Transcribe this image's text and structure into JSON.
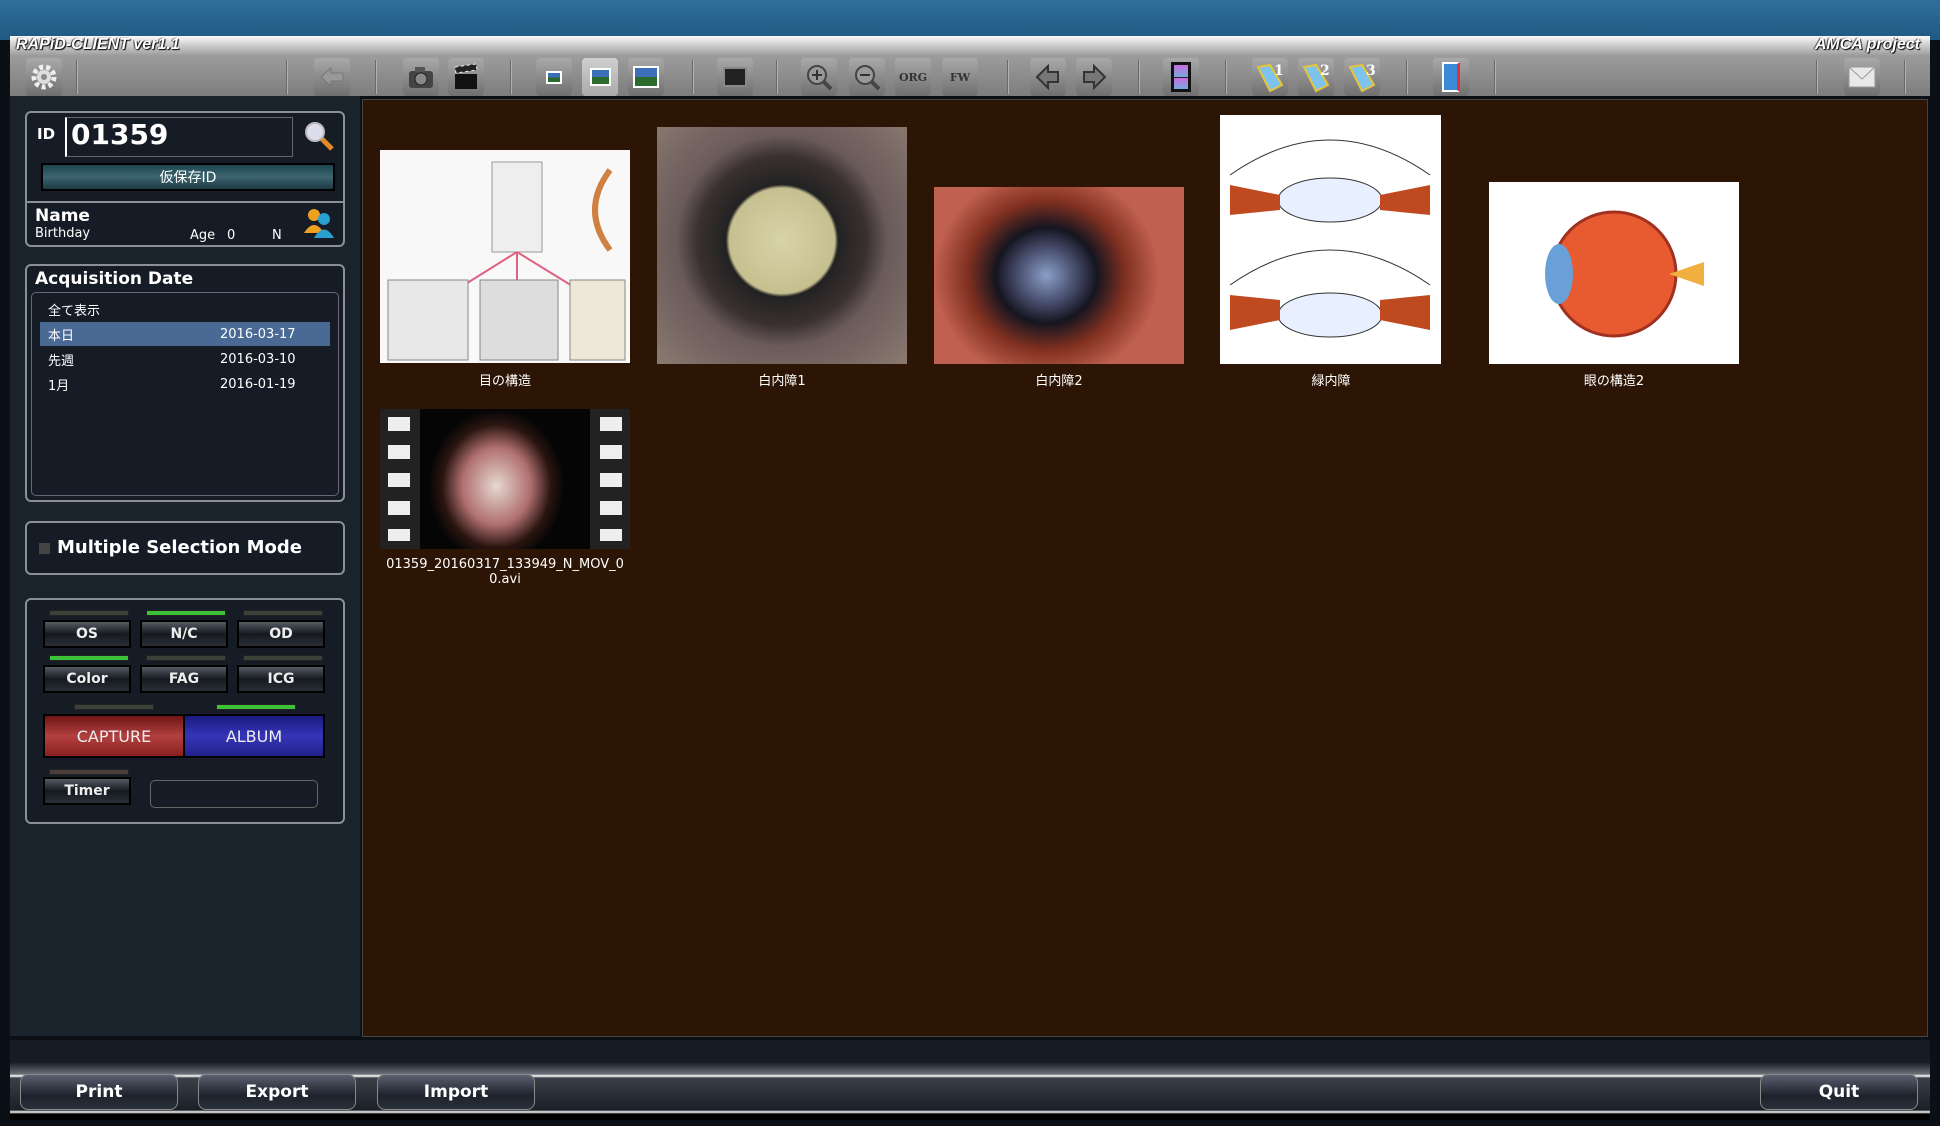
{
  "app": {
    "title": "RAPiD-CLIENT ver1.1",
    "project": "AMCA project"
  },
  "toolbar": {
    "icons": [
      "gear-icon",
      "back-arrow-icon",
      "camera-icon",
      "clapperboard-icon",
      "image-small-icon",
      "image-medium-icon",
      "image-large-icon",
      "gallery-icon",
      "zoom-in-icon",
      "zoom-out-icon",
      "org-icon",
      "fw-icon",
      "previous-icon",
      "next-icon",
      "film-icon",
      "tag-1-icon",
      "tag-2-icon",
      "tag-3-icon",
      "notebook-icon",
      "mail-icon"
    ],
    "org_label": "ORG",
    "fw_label": "FW",
    "tag1": "1",
    "tag2": "2",
    "tag3": "3"
  },
  "patient": {
    "id_label": "ID",
    "id_value": "01359",
    "temp_id_button": "仮保存ID",
    "name_label": "Name",
    "birthday_label": "Birthday",
    "age_label": "Age",
    "age_value": "0",
    "sex_value": "N"
  },
  "acquisition": {
    "title": "Acquisition Date",
    "items": [
      {
        "label": "全て表示",
        "date": ""
      },
      {
        "label": "本日",
        "date": "2016-03-17",
        "selected": true
      },
      {
        "label": "先週",
        "date": "2016-03-10"
      },
      {
        "label": "1月",
        "date": "2016-01-19"
      }
    ]
  },
  "multi_select": {
    "label": "Multiple Selection Mode",
    "checked": false
  },
  "controls": {
    "os": "OS",
    "nc": "N/C",
    "od": "OD",
    "color": "Color",
    "fag": "FAG",
    "icg": "ICG",
    "capture": "CAPTURE",
    "album": "ALBUM",
    "timer": "Timer",
    "timer_value": "",
    "active": [
      "N/C",
      "Color",
      "ALBUM"
    ]
  },
  "gallery": {
    "items": [
      {
        "label": "目の構造"
      },
      {
        "label": "白内障1"
      },
      {
        "label": "白内障2"
      },
      {
        "label": "緑内障"
      },
      {
        "label": "眼の構造2"
      },
      {
        "label": "01359_20160317_133949_N_MOV_00.avi",
        "type": "video"
      }
    ]
  },
  "footer": {
    "print": "Print",
    "export": "Export",
    "import": "Import",
    "quit": "Quit"
  }
}
